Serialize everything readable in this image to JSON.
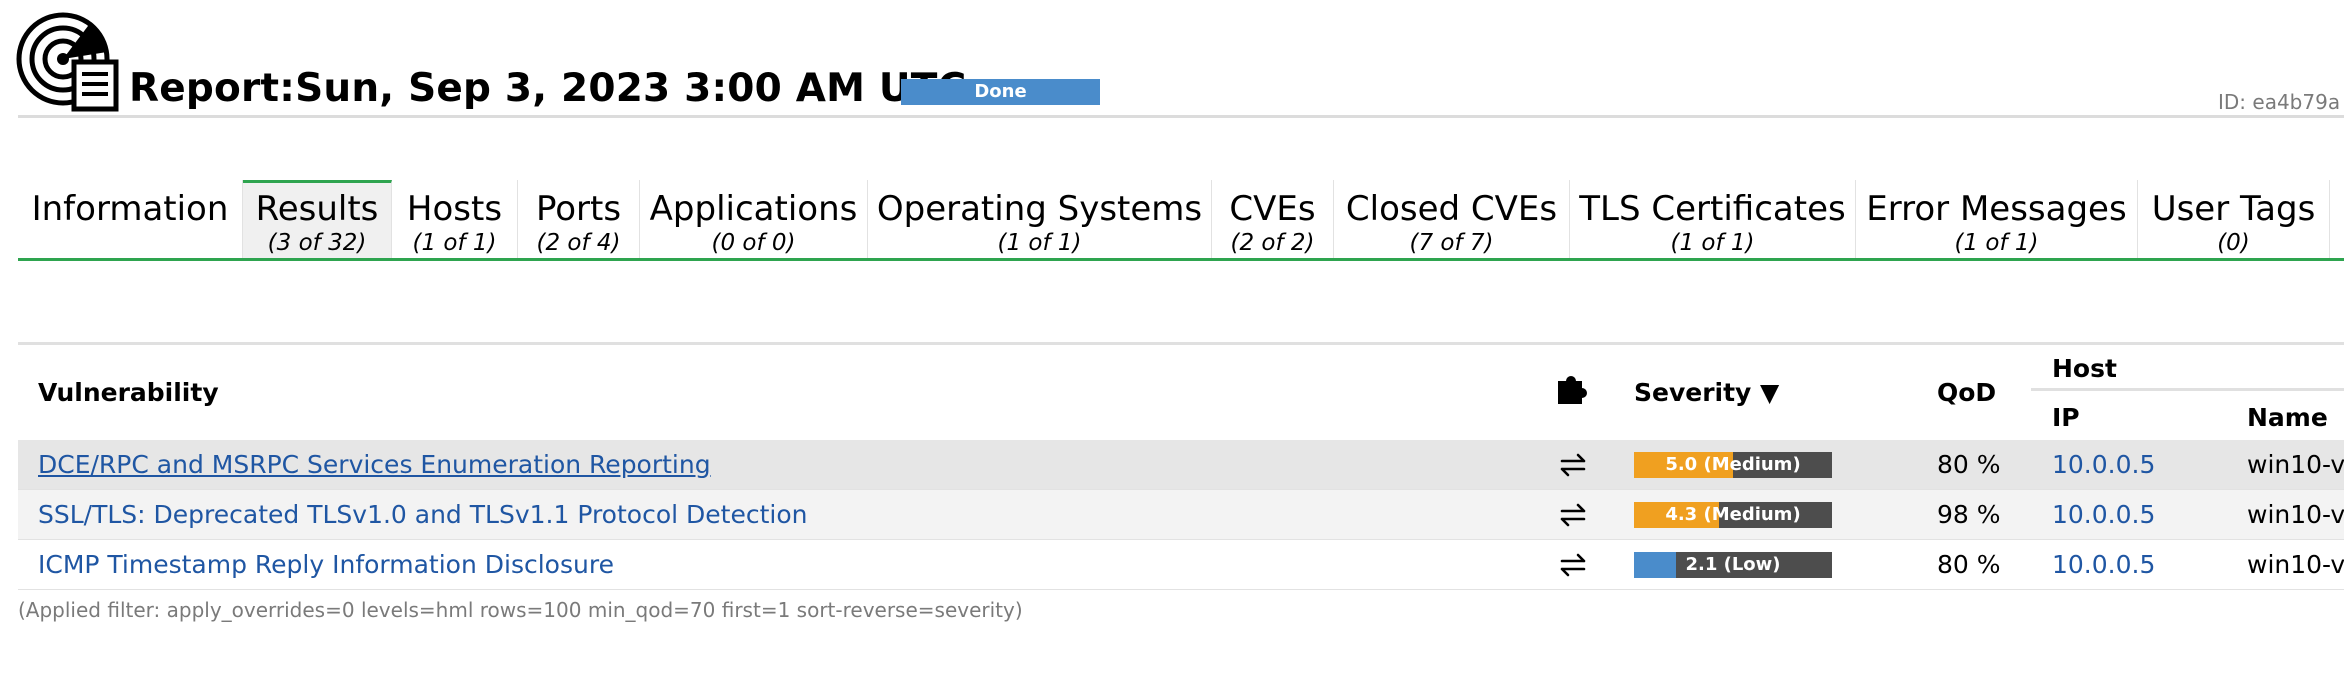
{
  "header": {
    "title": "Report:Sun, Sep 3, 2023 3:00 AM UTC",
    "status": "Done",
    "status_color": "#4a8ccb",
    "report_id": "ID: ea4b79a"
  },
  "tabs": [
    {
      "label": "Information",
      "count": ""
    },
    {
      "label": "Results",
      "count": "(3 of 32)",
      "active": true
    },
    {
      "label": "Hosts",
      "count": "(1 of 1)"
    },
    {
      "label": "Ports",
      "count": "(2 of 4)"
    },
    {
      "label": "Applications",
      "count": "(0 of 0)"
    },
    {
      "label": "Operating Systems",
      "count": "(1 of 1)"
    },
    {
      "label": "CVEs",
      "count": "(2 of 2)"
    },
    {
      "label": "Closed CVEs",
      "count": "(7 of 7)"
    },
    {
      "label": "TLS Certificates",
      "count": "(1 of 1)"
    },
    {
      "label": "Error Messages",
      "count": "(1 of 1)"
    },
    {
      "label": "User Tags",
      "count": "(0)"
    }
  ],
  "table": {
    "headers": {
      "vulnerability": "Vulnerability",
      "severity": "Severity ▼",
      "qod": "QoD",
      "host": "Host",
      "ip": "IP",
      "name": "Name"
    },
    "rows": [
      {
        "vulnerability": "DCE/RPC and MSRPC Services Enumeration Reporting",
        "severity_label": "5.0 (Medium)",
        "severity_score": 5.0,
        "severity_color": "#f0a020",
        "qod": "80 %",
        "ip": "10.0.0.5",
        "name": "win10-v"
      },
      {
        "vulnerability": "SSL/TLS: Deprecated TLSv1.0 and TLSv1.1 Protocol Detection",
        "severity_label": "4.3 (Medium)",
        "severity_score": 4.3,
        "severity_color": "#f0a020",
        "qod": "98 %",
        "ip": "10.0.0.5",
        "name": "win10-v"
      },
      {
        "vulnerability": "ICMP Timestamp Reply Information Disclosure",
        "severity_label": "2.1 (Low)",
        "severity_score": 2.1,
        "severity_color": "#4a8ccb",
        "qod": "80 %",
        "ip": "10.0.0.5",
        "name": "win10-v"
      }
    ]
  },
  "filter_text": "(Applied filter: apply_overrides=0 levels=hml rows=100 min_qod=70 first=1 sort-reverse=severity)",
  "icons": {
    "report": "report-radar-icon",
    "plugin": "puzzle-icon",
    "override": "override-arrows-icon"
  }
}
